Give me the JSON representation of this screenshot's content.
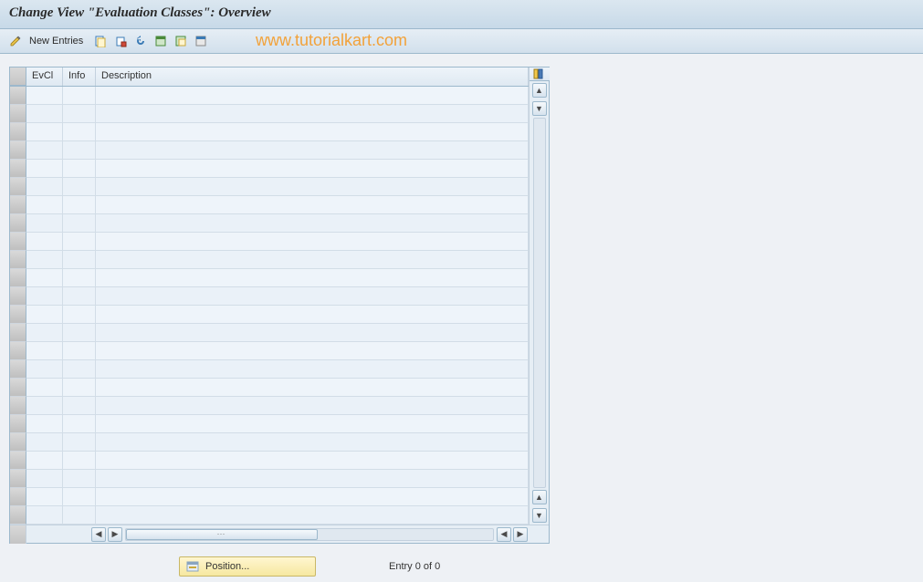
{
  "titlebar": {
    "title": "Change View \"Evaluation Classes\": Overview"
  },
  "toolbar": {
    "new_entries_label": "New Entries",
    "icons": [
      "pencil",
      "copy",
      "delete",
      "undo",
      "select-all",
      "select-block",
      "deselect"
    ]
  },
  "watermark": {
    "text": "www.tutorialkart.com"
  },
  "grid": {
    "columns": {
      "evcl": "EvCl",
      "info": "Info",
      "desc": "Description"
    },
    "row_count": 24
  },
  "footer": {
    "position_label": "Position...",
    "entry_text": "Entry 0 of 0"
  }
}
